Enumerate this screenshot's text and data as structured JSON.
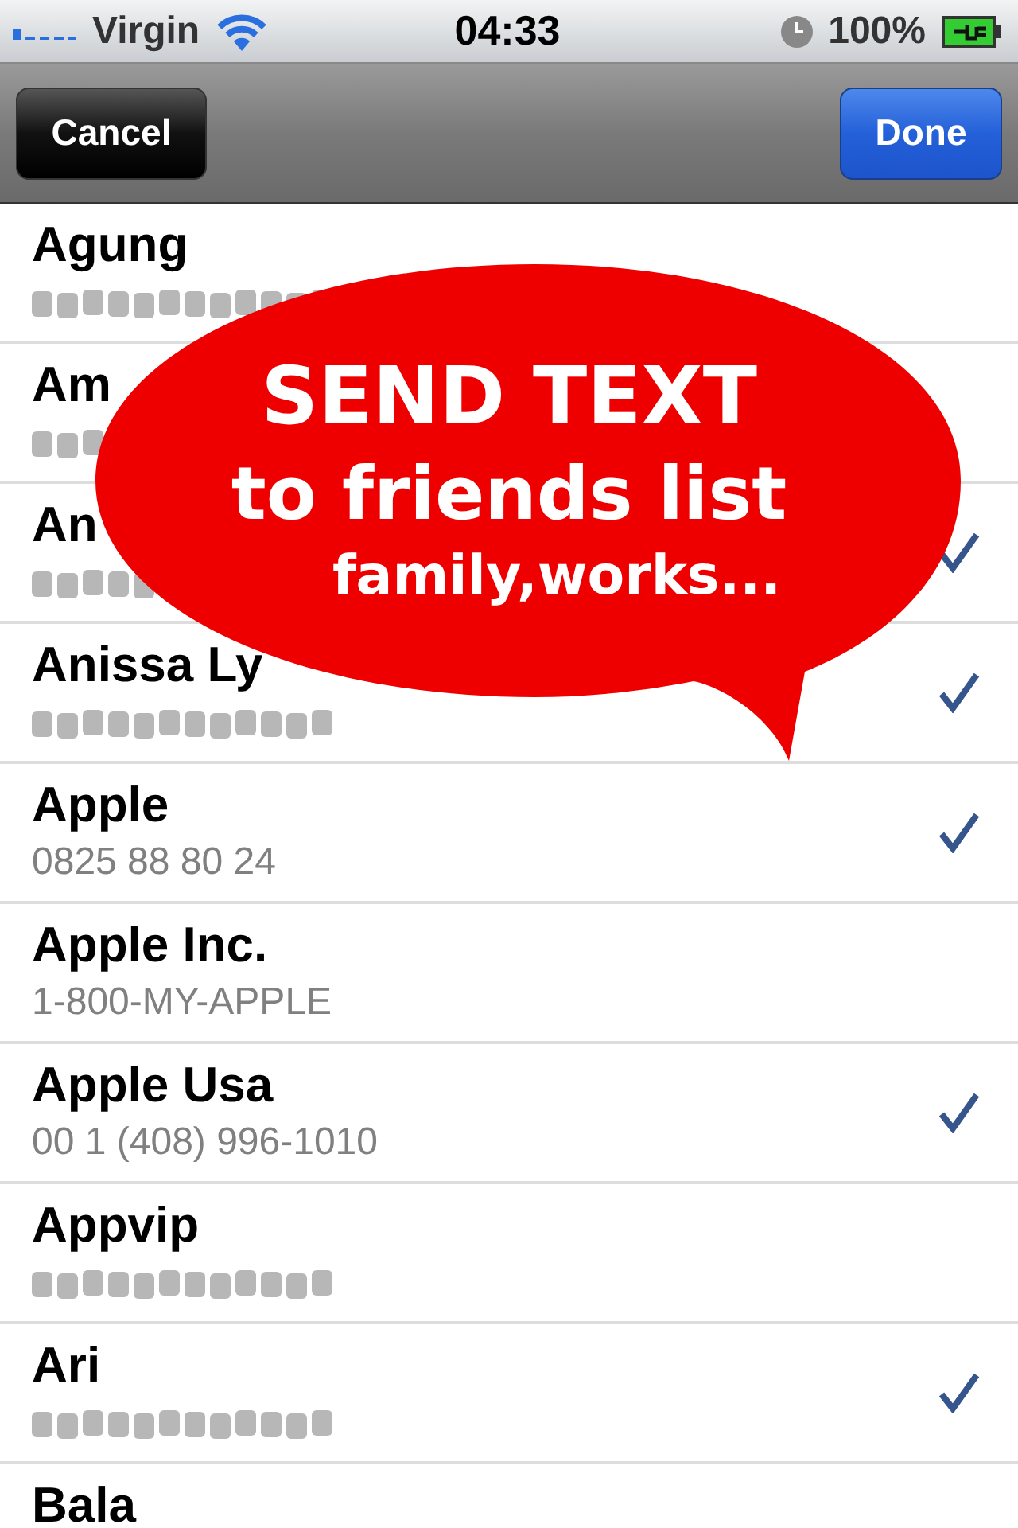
{
  "status_bar": {
    "carrier": "Virgin",
    "time": "04:33",
    "battery": "100%"
  },
  "nav_bar": {
    "cancel": "Cancel",
    "done": "Done"
  },
  "contacts": [
    {
      "name": "Agung",
      "phone_blurred": true,
      "checked": false
    },
    {
      "name": "Am",
      "phone_blurred": true,
      "checked": false
    },
    {
      "name": "An",
      "phone_blurred": true,
      "checked": true
    },
    {
      "name": "Anissa Ly",
      "phone_blurred": true,
      "checked": true
    },
    {
      "name": "Apple",
      "phone": "0825 88 80 24",
      "checked": true
    },
    {
      "name": "Apple Inc.",
      "phone": "1-800-MY-APPLE",
      "checked": false
    },
    {
      "name": "Apple Usa",
      "phone": "00 1 (408) 996-1010",
      "checked": true
    },
    {
      "name": "Appvip",
      "phone_blurred": true,
      "checked": false
    },
    {
      "name": "Ari",
      "phone_blurred": true,
      "checked": true
    },
    {
      "name": "Bala",
      "checked": false
    }
  ],
  "promo_bubble": {
    "headline": "SEND TEXT",
    "line_2": "to friends list",
    "line_3": "family,works..."
  }
}
